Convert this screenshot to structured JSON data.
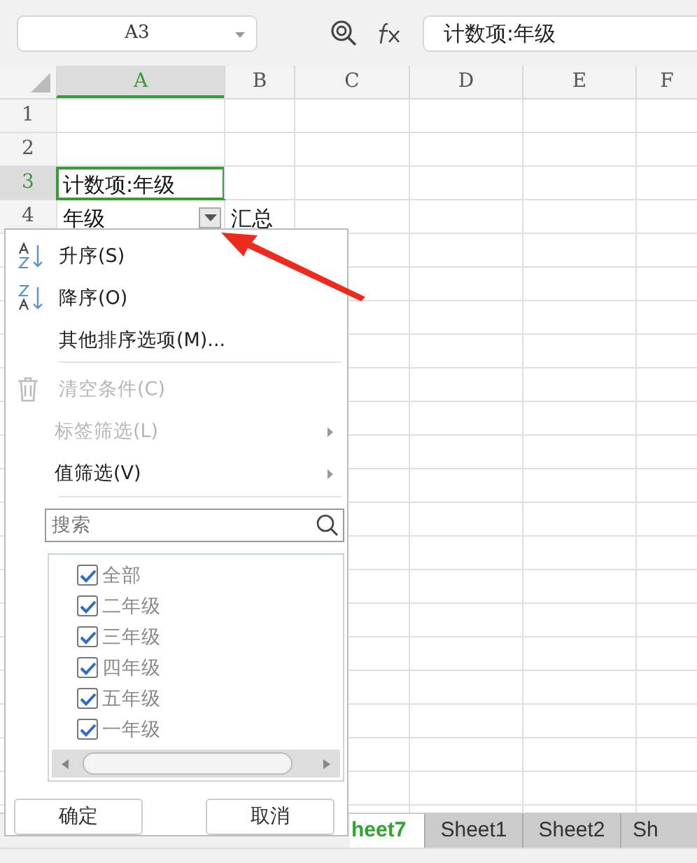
{
  "name_box": "A3",
  "formula": {
    "value": "计数项:年级"
  },
  "columns": [
    {
      "label": "A",
      "selected": true
    },
    {
      "label": "B",
      "selected": false
    },
    {
      "label": "C",
      "selected": false
    },
    {
      "label": "D",
      "selected": false
    },
    {
      "label": "E",
      "selected": false
    },
    {
      "label": "F",
      "selected": false
    }
  ],
  "rows": [
    {
      "number": "1",
      "selected": false,
      "cells": []
    },
    {
      "number": "2",
      "selected": false,
      "cells": []
    },
    {
      "number": "3",
      "selected": true,
      "cells": [
        {
          "text": "计数项:年级",
          "selected": true,
          "filter": false
        }
      ]
    },
    {
      "number": "4",
      "selected": false,
      "cells": [
        {
          "text": "年级",
          "selected": false,
          "filter": true
        },
        {
          "text": "汇总",
          "selected": false,
          "filter": false
        }
      ]
    }
  ],
  "filter_menu": {
    "items": [
      {
        "kind": "sort-asc",
        "label": "升序(S)",
        "disabled": false
      },
      {
        "kind": "sort-desc",
        "label": "降序(O)",
        "disabled": false
      },
      {
        "kind": "option",
        "label": "其他排序选项(M)...",
        "disabled": false
      },
      {
        "kind": "separator"
      },
      {
        "kind": "clear",
        "label": "清空条件(C)",
        "disabled": true
      },
      {
        "kind": "submenu",
        "label": "标签筛选(L)",
        "disabled": true
      },
      {
        "kind": "submenu",
        "label": "值筛选(V)",
        "disabled": false
      },
      {
        "kind": "separator"
      }
    ],
    "search": {
      "placeholder": "搜索"
    },
    "values": [
      {
        "label": "全部",
        "checked": true
      },
      {
        "label": "二年级",
        "checked": true
      },
      {
        "label": "三年级",
        "checked": true
      },
      {
        "label": "四年级",
        "checked": true
      },
      {
        "label": "五年级",
        "checked": true
      },
      {
        "label": "一年级",
        "checked": true
      }
    ],
    "buttons": [
      "确定",
      "取消"
    ]
  },
  "sheet_tabs": [
    {
      "label": "heet7",
      "selected": true
    },
    {
      "label": "Sheet1",
      "selected": false
    },
    {
      "label": "Sheet2",
      "selected": false
    },
    {
      "label": "Sh",
      "selected": false
    }
  ]
}
